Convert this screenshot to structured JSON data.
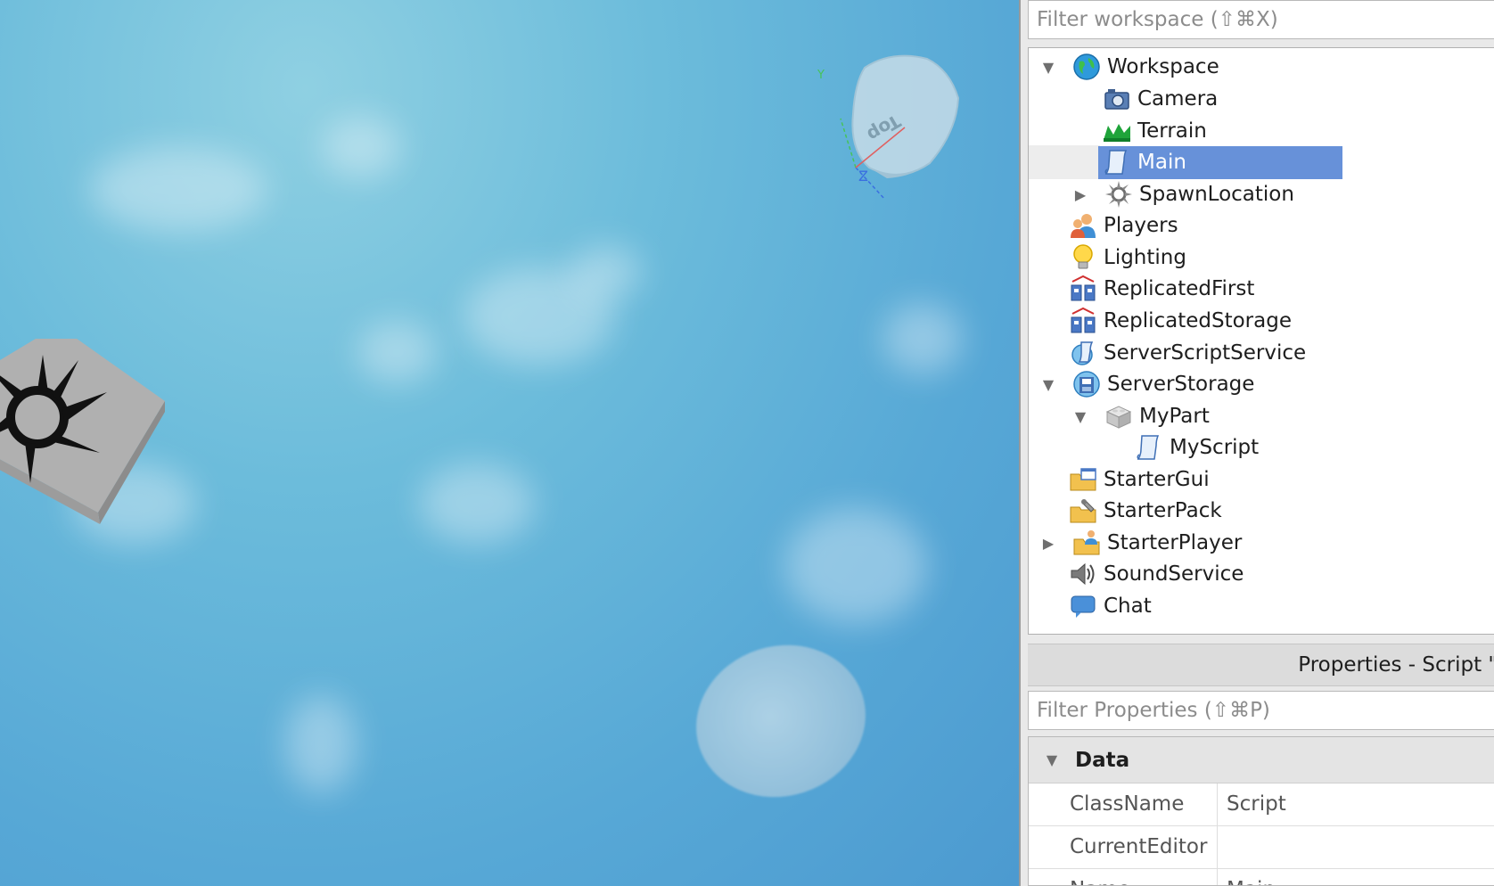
{
  "viewport": {
    "view_cube": {
      "face_label": "Top",
      "axis_y_label": "Y",
      "axis_z_label": "Z"
    }
  },
  "explorer": {
    "filter_placeholder": "Filter workspace (⇧⌘X)",
    "items": [
      {
        "label": "Workspace",
        "depth": 0,
        "expander": "expanded",
        "icon": "globe-icon"
      },
      {
        "label": "Camera",
        "depth": 1,
        "expander": "none",
        "icon": "camera-icon"
      },
      {
        "label": "Terrain",
        "depth": 1,
        "expander": "none",
        "icon": "terrain-icon"
      },
      {
        "label": "Main",
        "depth": 1,
        "expander": "none",
        "icon": "script-icon",
        "selected": true
      },
      {
        "label": "SpawnLocation",
        "depth": 1,
        "expander": "collapsed",
        "icon": "spawn-icon"
      },
      {
        "label": "Players",
        "depth": 0,
        "expander": "none",
        "icon": "players-icon"
      },
      {
        "label": "Lighting",
        "depth": 0,
        "expander": "none",
        "icon": "lightbulb-icon"
      },
      {
        "label": "ReplicatedFirst",
        "depth": 0,
        "expander": "none",
        "icon": "replicated-icon"
      },
      {
        "label": "ReplicatedStorage",
        "depth": 0,
        "expander": "none",
        "icon": "replicated-icon"
      },
      {
        "label": "ServerScriptService",
        "depth": 0,
        "expander": "none",
        "icon": "server-script-icon"
      },
      {
        "label": "ServerStorage",
        "depth": 0,
        "expander": "expanded",
        "icon": "server-storage-icon"
      },
      {
        "label": "MyPart",
        "depth": 1,
        "expander": "expanded",
        "icon": "part-icon"
      },
      {
        "label": "MyScript",
        "depth": 2,
        "expander": "none",
        "icon": "script-icon"
      },
      {
        "label": "StarterGui",
        "depth": 0,
        "expander": "none",
        "icon": "starter-gui-icon"
      },
      {
        "label": "StarterPack",
        "depth": 0,
        "expander": "none",
        "icon": "starter-pack-icon"
      },
      {
        "label": "StarterPlayer",
        "depth": 0,
        "expander": "collapsed",
        "icon": "starter-player-icon"
      },
      {
        "label": "SoundService",
        "depth": 0,
        "expander": "none",
        "icon": "sound-icon"
      },
      {
        "label": "Chat",
        "depth": 0,
        "expander": "none",
        "icon": "chat-icon"
      }
    ]
  },
  "properties": {
    "title": "Properties - Script \"",
    "filter_placeholder": "Filter Properties (⇧⌘P)",
    "category": "Data",
    "rows": [
      {
        "name": "ClassName",
        "value": "Script"
      },
      {
        "name": "CurrentEditor",
        "value": ""
      },
      {
        "name": "Name",
        "value": "Main"
      }
    ]
  }
}
